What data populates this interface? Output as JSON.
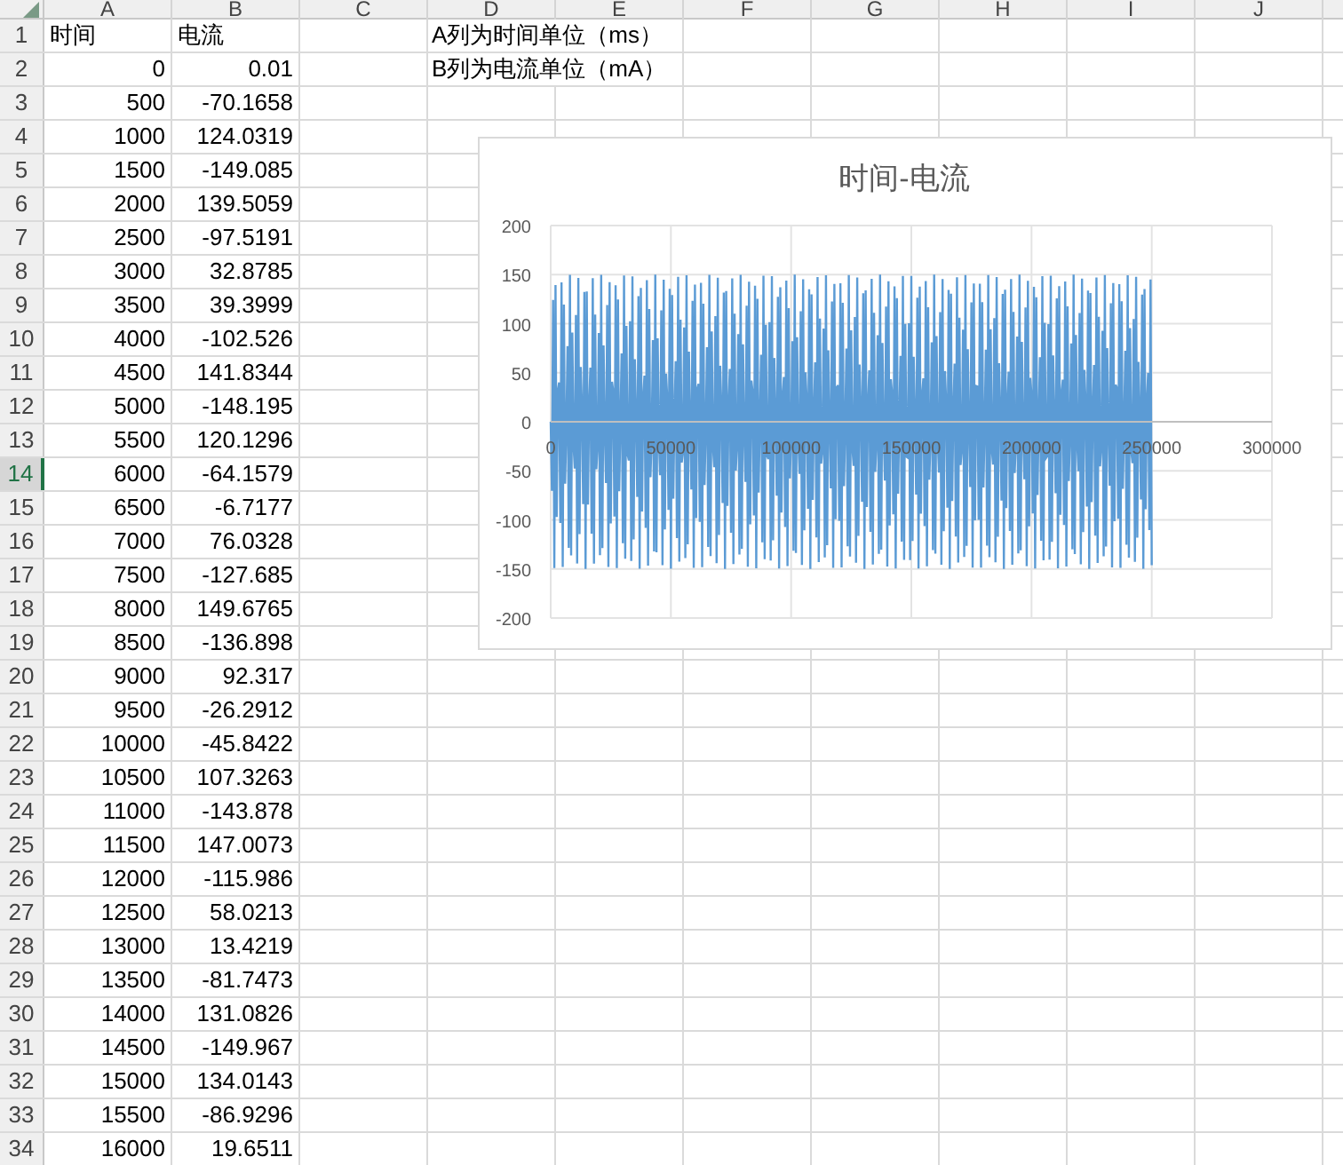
{
  "column_headers": [
    "A",
    "B",
    "C",
    "D",
    "E",
    "F",
    "G",
    "H",
    "I",
    "J"
  ],
  "rows": [
    {
      "number": "1",
      "selected": false,
      "kind": "text",
      "a": "时间",
      "b": "电流",
      "d": "A列为时间单位（ms）"
    },
    {
      "number": "2",
      "selected": false,
      "kind": "number",
      "a": "0",
      "b": "0.01",
      "d": "B列为电流单位（mA）"
    },
    {
      "number": "3",
      "selected": false,
      "kind": "number",
      "a": "500",
      "b": "-70.1658"
    },
    {
      "number": "4",
      "selected": false,
      "kind": "number",
      "a": "1000",
      "b": "124.0319"
    },
    {
      "number": "5",
      "selected": false,
      "kind": "number",
      "a": "1500",
      "b": "-149.085"
    },
    {
      "number": "6",
      "selected": false,
      "kind": "number",
      "a": "2000",
      "b": "139.5059"
    },
    {
      "number": "7",
      "selected": false,
      "kind": "number",
      "a": "2500",
      "b": "-97.5191"
    },
    {
      "number": "8",
      "selected": false,
      "kind": "number",
      "a": "3000",
      "b": "32.8785"
    },
    {
      "number": "9",
      "selected": false,
      "kind": "number",
      "a": "3500",
      "b": "39.3999"
    },
    {
      "number": "10",
      "selected": false,
      "kind": "number",
      "a": "4000",
      "b": "-102.526"
    },
    {
      "number": "11",
      "selected": false,
      "kind": "number",
      "a": "4500",
      "b": "141.8344"
    },
    {
      "number": "12",
      "selected": false,
      "kind": "number",
      "a": "5000",
      "b": "-148.195"
    },
    {
      "number": "13",
      "selected": false,
      "kind": "number",
      "a": "5500",
      "b": "120.1296"
    },
    {
      "number": "14",
      "selected": true,
      "kind": "number",
      "a": "6000",
      "b": "-64.1579"
    },
    {
      "number": "15",
      "selected": false,
      "kind": "number",
      "a": "6500",
      "b": "-6.7177"
    },
    {
      "number": "16",
      "selected": false,
      "kind": "number",
      "a": "7000",
      "b": "76.0328"
    },
    {
      "number": "17",
      "selected": false,
      "kind": "number",
      "a": "7500",
      "b": "-127.685"
    },
    {
      "number": "18",
      "selected": false,
      "kind": "number",
      "a": "8000",
      "b": "149.6765"
    },
    {
      "number": "19",
      "selected": false,
      "kind": "number",
      "a": "8500",
      "b": "-136.898"
    },
    {
      "number": "20",
      "selected": false,
      "kind": "number",
      "a": "9000",
      "b": "92.317"
    },
    {
      "number": "21",
      "selected": false,
      "kind": "number",
      "a": "9500",
      "b": "-26.2912"
    },
    {
      "number": "22",
      "selected": false,
      "kind": "number",
      "a": "10000",
      "b": "-45.8422"
    },
    {
      "number": "23",
      "selected": false,
      "kind": "number",
      "a": "10500",
      "b": "107.3263"
    },
    {
      "number": "24",
      "selected": false,
      "kind": "number",
      "a": "11000",
      "b": "-143.878"
    },
    {
      "number": "25",
      "selected": false,
      "kind": "number",
      "a": "11500",
      "b": "147.0073"
    },
    {
      "number": "26",
      "selected": false,
      "kind": "number",
      "a": "12000",
      "b": "-115.986"
    },
    {
      "number": "27",
      "selected": false,
      "kind": "number",
      "a": "12500",
      "b": "58.0213"
    },
    {
      "number": "28",
      "selected": false,
      "kind": "number",
      "a": "13000",
      "b": "13.4219"
    },
    {
      "number": "29",
      "selected": false,
      "kind": "number",
      "a": "13500",
      "b": "-81.7473"
    },
    {
      "number": "30",
      "selected": false,
      "kind": "number",
      "a": "14000",
      "b": "131.0826"
    },
    {
      "number": "31",
      "selected": false,
      "kind": "number",
      "a": "14500",
      "b": "-149.967"
    },
    {
      "number": "32",
      "selected": false,
      "kind": "number",
      "a": "15000",
      "b": "134.0143"
    },
    {
      "number": "33",
      "selected": false,
      "kind": "number",
      "a": "15500",
      "b": "-86.9296"
    },
    {
      "number": "34",
      "selected": false,
      "kind": "number",
      "a": "16000",
      "b": "19.6511"
    }
  ],
  "chart": {
    "title": "时间-电流",
    "y_tick_labels": [
      "200",
      "150",
      "100",
      "50",
      "0",
      "-50",
      "-100",
      "-150",
      "-200"
    ],
    "x_tick_labels": [
      "0",
      "50000",
      "100000",
      "150000",
      "200000",
      "250000",
      "300000"
    ]
  }
}
